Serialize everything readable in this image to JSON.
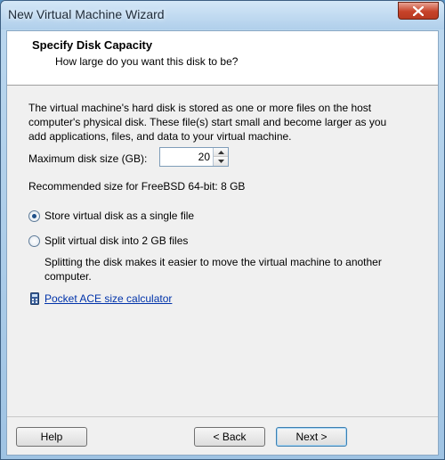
{
  "window": {
    "title": "New Virtual Machine Wizard"
  },
  "header": {
    "title": "Specify Disk Capacity",
    "subtitle": "How large do you want this disk to be?"
  },
  "main": {
    "description": "The virtual machine's hard disk is stored as one or more files on the host computer's physical disk. These file(s) start small and become larger as you add applications, files, and data to your virtual machine.",
    "max_size_label": "Maximum disk size (GB):",
    "max_size_value": "20",
    "recommended": "Recommended size for FreeBSD 64-bit: 8 GB",
    "options": [
      {
        "label": "Store virtual disk as a single file",
        "selected": true
      },
      {
        "label": "Split virtual disk into 2 GB files",
        "selected": false
      }
    ],
    "split_description": "Splitting the disk makes it easier to move the virtual machine to another computer.",
    "calculator_link": "Pocket ACE size calculator"
  },
  "footer": {
    "help_label": "Help",
    "back_label": "< Back",
    "next_label": "Next >"
  },
  "colors": {
    "link": "#0033aa",
    "radio_dot": "#1f4f88",
    "close_button": "#c7432a"
  },
  "icons": [
    "close-icon",
    "spin-up-icon",
    "spin-down-icon",
    "calculator-icon"
  ]
}
